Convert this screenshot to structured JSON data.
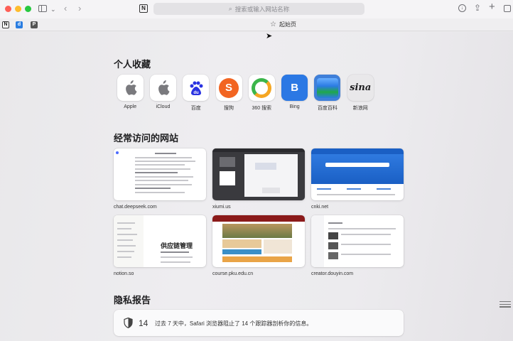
{
  "toolbar": {
    "url_placeholder": "搜索或输入网站名称",
    "back_glyph": "‹",
    "forward_glyph": "›",
    "page_icon_letter": "N"
  },
  "favorites_bar": {
    "items": [
      "N",
      "d",
      "P"
    ],
    "active_tab": "起始页"
  },
  "sections": {
    "favorites_title": "个人收藏",
    "frequent_title": "经常访问的网站",
    "privacy_title": "隐私报告"
  },
  "favorites": [
    {
      "label": "Apple",
      "icon": "apple-icon"
    },
    {
      "label": "iCloud",
      "icon": "apple-icon"
    },
    {
      "label": "百度",
      "icon": "baidu-icon",
      "glyph": "du"
    },
    {
      "label": "搜狗",
      "icon": "sogou-icon",
      "glyph": "S"
    },
    {
      "label": "360 搜索",
      "icon": "360-icon"
    },
    {
      "label": "Bing",
      "icon": "bing-icon",
      "glyph": "B"
    },
    {
      "label": "百度百科",
      "icon": "baike-icon"
    },
    {
      "label": "新浪网",
      "icon": "sina-icon",
      "glyph": "sina"
    }
  ],
  "frequent": [
    {
      "label": "chat.deepseek.com"
    },
    {
      "label": "xiumi.us"
    },
    {
      "label": "cnki.net"
    },
    {
      "label": "notion.so",
      "thumb_title": "供应链管理"
    },
    {
      "label": "course.pku.edu.cn"
    },
    {
      "label": "creator.douyin.com"
    }
  ],
  "privacy": {
    "count": "14",
    "text": "过去 7 天中，Safari 浏览器阻止了 14 个跟踪器剖析你的信息。"
  },
  "colors": {
    "bing": "#2b78e4",
    "sogou": "#f26522",
    "baidu": "#2932e1",
    "cnki_blue": "#1a5fc4"
  }
}
